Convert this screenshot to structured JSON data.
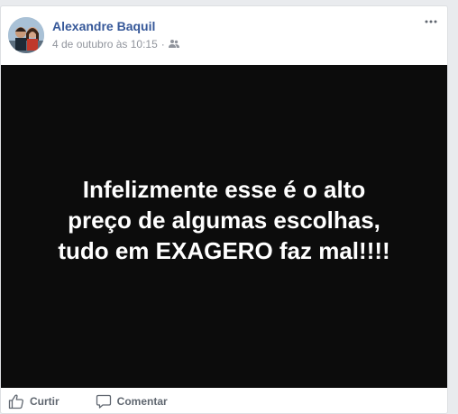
{
  "post": {
    "author": "Alexandre Baquil",
    "timestamp": "4 de outubro às 10:15",
    "privacy_icon": "friends-icon",
    "image_text_lines": [
      "Infelizmente esse é o alto",
      "preço de algumas escolhas,",
      "tudo em EXAGERO faz mal!!!!"
    ],
    "image_background": "#0c0c0c"
  },
  "actions": {
    "like_label": "Curtir",
    "comment_label": "Comentar"
  },
  "colors": {
    "author_link": "#365899",
    "meta_text": "#90949c",
    "action_text": "#606770"
  }
}
